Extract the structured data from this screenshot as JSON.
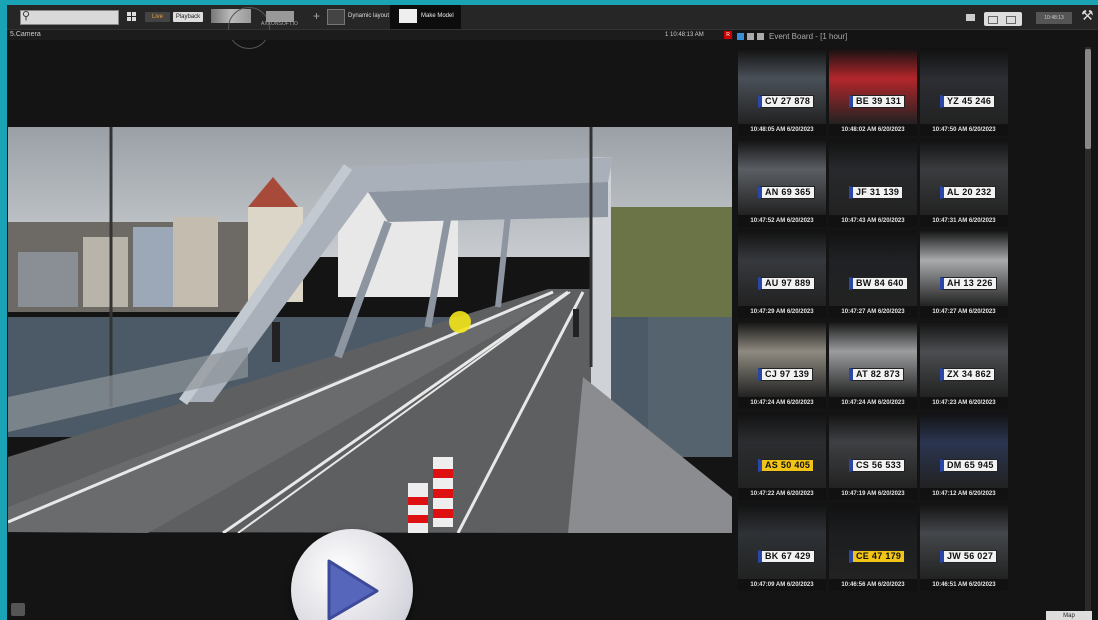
{
  "toolbar": {
    "live_label": "Live",
    "playback_label": "Playback",
    "axx_label": "AXXONSOFT.IO",
    "plus_label": "+",
    "dynamic_layout_label": "Dynamic layout",
    "make_model_label": "Make Model",
    "clock_label": "10:48:13"
  },
  "camera": {
    "name": "5.Camera",
    "info": "1  10:48:13 AM",
    "rec_badge": "R"
  },
  "event_board": {
    "title": "Event Board - [1 hour]",
    "events": [
      {
        "plate": "CV 27 878",
        "time": "10:48:05 AM 6/20/2023",
        "car_color": "#4a5058",
        "plate_style": "white"
      },
      {
        "plate": "BE 39 131",
        "time": "10:48:02 AM 6/20/2023",
        "car_color": "#b3262b",
        "plate_style": "white"
      },
      {
        "plate": "YZ 45 246",
        "time": "10:47:50 AM 6/20/2023",
        "car_color": "#2c2e33",
        "plate_style": "white"
      },
      {
        "plate": "AN 69 365",
        "time": "10:47:52 AM 6/20/2023",
        "car_color": "#5a5e63",
        "plate_style": "white"
      },
      {
        "plate": "JF 31 139",
        "time": "10:47:43 AM 6/20/2023",
        "car_color": "#27292c",
        "plate_style": "white"
      },
      {
        "plate": "AL 20 232",
        "time": "10:47:31 AM 6/20/2023",
        "car_color": "#3a3c3f",
        "plate_style": "white"
      },
      {
        "plate": "AU 97 889",
        "time": "10:47:29 AM 6/20/2023",
        "car_color": "#36393d",
        "plate_style": "white"
      },
      {
        "plate": "BW 84 640",
        "time": "10:47:27 AM 6/20/2023",
        "car_color": "#1f2124",
        "plate_style": "white"
      },
      {
        "plate": "AH 13 226",
        "time": "10:47:27 AM 6/20/2023",
        "car_color": "#a8aaac",
        "plate_style": "white"
      },
      {
        "plate": "CJ 97 139",
        "time": "10:47:24 AM 6/20/2023",
        "car_color": "#8e8a80",
        "plate_style": "white"
      },
      {
        "plate": "AT 82 873",
        "time": "10:47:24 AM 6/20/2023",
        "car_color": "#9a9c9e",
        "plate_style": "white"
      },
      {
        "plate": "ZX 34 862",
        "time": "10:47:23 AM 6/20/2023",
        "car_color": "#4b4d50",
        "plate_style": "white"
      },
      {
        "plate": "AS 50 405",
        "time": "10:47:22 AM 6/20/2023",
        "car_color": "#2b2d30",
        "plate_style": "yellow"
      },
      {
        "plate": "CS 56 533",
        "time": "10:47:19 AM 6/20/2023",
        "car_color": "#3e4043",
        "plate_style": "white"
      },
      {
        "plate": "DM 65 945",
        "time": "10:47:12 AM 6/20/2023",
        "car_color": "#2a3550",
        "plate_style": "white"
      },
      {
        "plate": "BK 67 429",
        "time": "10:47:09 AM 6/20/2023",
        "car_color": "#2e3236",
        "plate_style": "white"
      },
      {
        "plate": "CE 47 179",
        "time": "10:46:56 AM 6/20/2023",
        "car_color": "#1b1d1f",
        "plate_style": "yellow"
      },
      {
        "plate": "JW 56 027",
        "time": "10:46:51 AM 6/20/2023",
        "car_color": "#44474b",
        "plate_style": "white"
      }
    ]
  },
  "map_label": "Map"
}
